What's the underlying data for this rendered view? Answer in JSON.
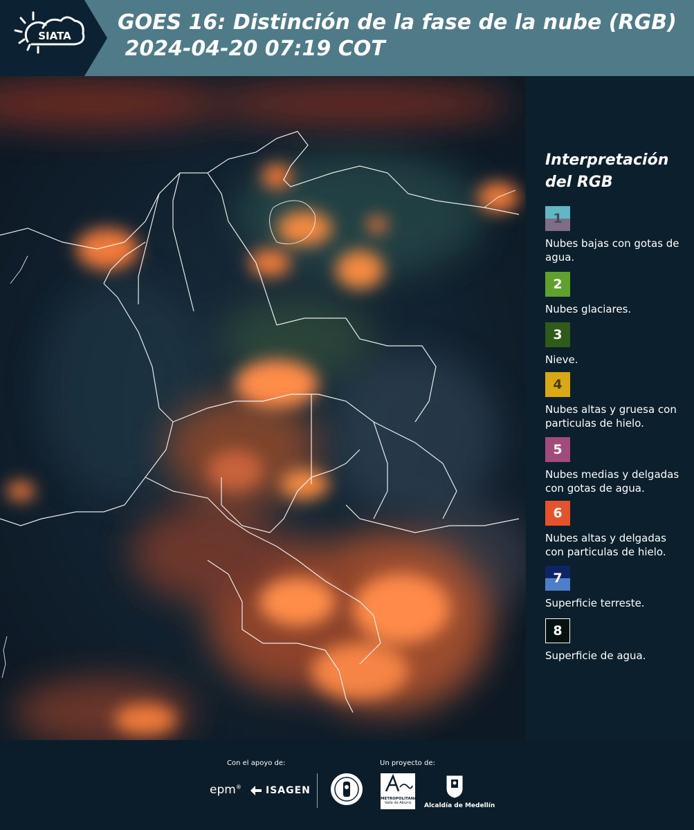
{
  "header": {
    "logo_text": "SIATA",
    "title_line1": "GOES 16: Distinción de la fase de la nube (RGB)",
    "title_line2": " 2024-04-20 07:19 COT"
  },
  "legend": {
    "title_line1": "Interpretación",
    "title_line2": "del RGB",
    "items": [
      {
        "number": "1",
        "label": "Nubes bajas con gotas de agua.",
        "color_top": "#62b7c4",
        "color_bottom": "#7d6e86",
        "number_color": "#4a4a55"
      },
      {
        "number": "2",
        "label": "Nubes glaciares.",
        "color": "#5fa12c",
        "number_color": "#ffffff"
      },
      {
        "number": "3",
        "label": "Nieve.",
        "color": "#2f5a19",
        "number_color": "#ffffff"
      },
      {
        "number": "4",
        "label": "Nubes altas y gruesa con particulas de hielo.",
        "color": "#d9a815",
        "number_color": "#4a3a0a"
      },
      {
        "number": "5",
        "label": "Nubes medias y delgadas con gotas de agua.",
        "color": "#a24a7c",
        "number_color": "#ffffff"
      },
      {
        "number": "6",
        "label": "Nubes altas y delgadas con particulas de hielo.",
        "color": "#e5532c",
        "number_color": "#ffffff"
      },
      {
        "number": "7",
        "label": "Superficie terreste.",
        "color_top": "#0e2466",
        "color_bottom": "#4f7ec9",
        "number_color": "#ffffff"
      },
      {
        "number": "8",
        "label": "Superficie de agua.",
        "color": "#061210",
        "number_color": "#ffffff"
      }
    ]
  },
  "footer": {
    "support_label": "Con el apoyo de:",
    "project_label": "Un proyecto de:",
    "sponsor_epm": "epm",
    "sponsor_isagen": "ISAGEN",
    "area_metro_name": "METROPOLITANA",
    "area_metro_sub": "Valle de Aburrá",
    "alcaldia": "Alcaldía de Medellín"
  }
}
